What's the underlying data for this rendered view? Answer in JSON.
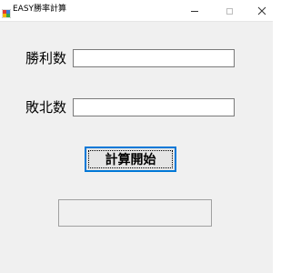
{
  "window": {
    "title": "EASY勝率計算",
    "icon": "app-icon"
  },
  "form": {
    "wins_label": "勝利数",
    "wins_value": "",
    "losses_label": "敗北数",
    "losses_value": "",
    "start_button_label": "計算開始",
    "result_text": ""
  },
  "colors": {
    "window_background": "#f0f0f0",
    "titlebar_background": "#ffffff",
    "button_focus_border": "#0078d7",
    "button_background": "#e5e5e5"
  }
}
